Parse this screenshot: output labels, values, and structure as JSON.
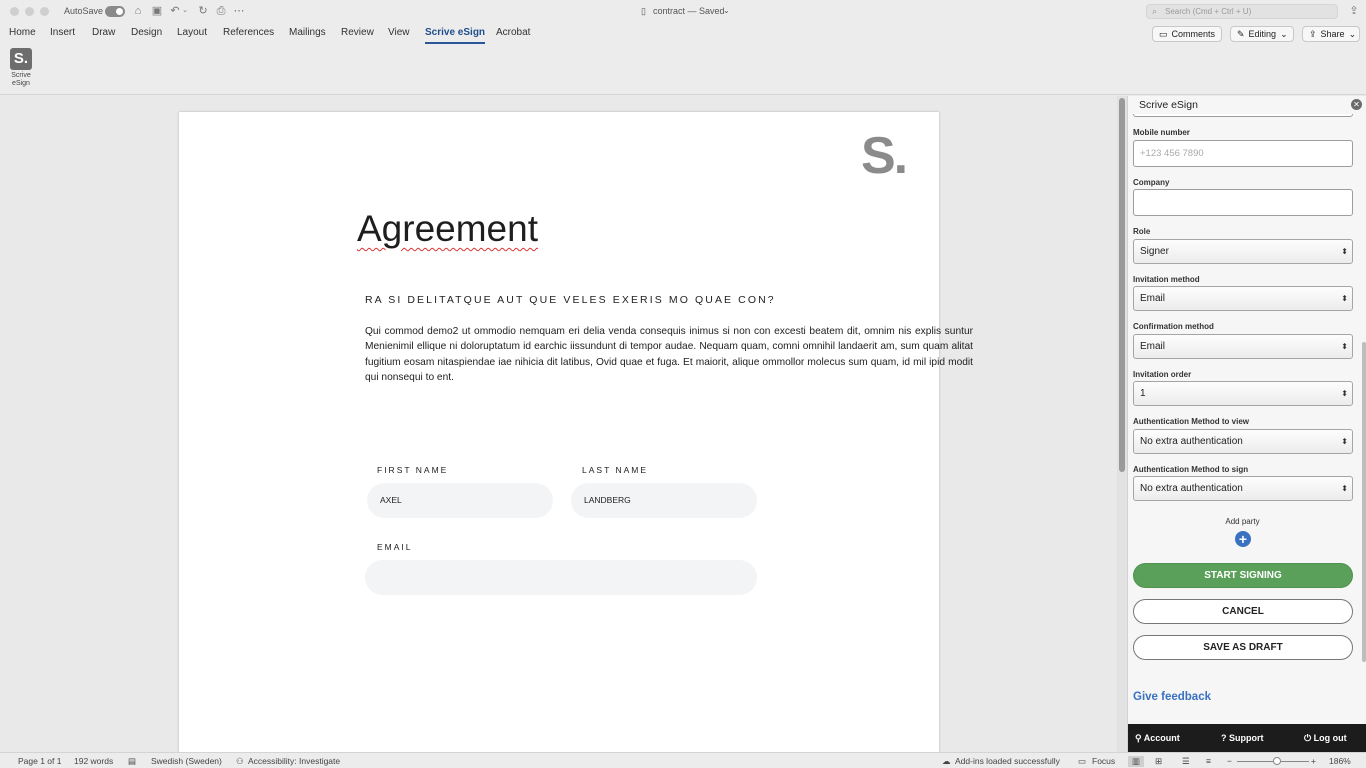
{
  "titlebar": {
    "autosave_label": "AutoSave",
    "doc_title": "contract — Saved",
    "search_placeholder": "Search (Cmd + Ctrl + U)"
  },
  "ribbon": {
    "tabs": [
      "Home",
      "Insert",
      "Draw",
      "Design",
      "Layout",
      "References",
      "Mailings",
      "Review",
      "View",
      "Scrive eSign",
      "Acrobat"
    ],
    "active_tab": "Scrive eSign",
    "comments_label": "Comments",
    "editing_label": "Editing",
    "share_label": "Share",
    "scrive_button_label": "Scrive eSign",
    "scrive_button_logo": "S."
  },
  "document": {
    "logo": "S.",
    "title": "Agreement",
    "subtitle": "RA SI DELITATQUE AUT QUE VELES EXERIS MO QUAE CON?",
    "body": "Qui commod demo2 ut ommodio nemquam eri delia venda consequis inimus si non con excesti beatem dit, omnim nis explis suntur Menienimil ellique ni doloruptatum id earchic iissundunt di tempor audae. Nequam quam, comni omnihil landaerit am, sum quam alitat fugitium eosam nitaspiendae iae nihicia dit latibus, Ovid quae et fuga. Et maiorit, alique ommollor molecus sum quam, id mil ipid modit qui nonsequi to ent.",
    "first_name_label": "FIRST NAME",
    "first_name_value": "AXEL",
    "last_name_label": "LAST NAME",
    "last_name_value": "LANDBERG",
    "email_label": "EMAIL",
    "email_value": ""
  },
  "pane": {
    "title": "Scrive eSign",
    "mobile_label": "Mobile number",
    "mobile_placeholder": "+123 456 7890",
    "company_label": "Company",
    "company_value": "",
    "role_label": "Role",
    "role_value": "Signer",
    "invitation_method_label": "Invitation method",
    "invitation_method_value": "Email",
    "confirmation_method_label": "Confirmation method",
    "confirmation_method_value": "Email",
    "invitation_order_label": "Invitation order",
    "invitation_order_value": "1",
    "auth_view_label": "Authentication Method to view",
    "auth_view_value": "No extra authentication",
    "auth_sign_label": "Authentication Method to sign",
    "auth_sign_value": "No extra authentication",
    "add_party_label": "Add party",
    "start_signing_label": "START SIGNING",
    "cancel_label": "CANCEL",
    "save_draft_label": "SAVE AS DRAFT",
    "feedback_label": "Give feedback",
    "footer": {
      "account_label": "Account",
      "support_label": "Support",
      "logout_label": "Log out"
    },
    "colors": {
      "accent_blue": "#3a71c1",
      "start_green": "#5aa05a"
    }
  },
  "statusbar": {
    "page": "Page 1 of 1",
    "words": "192 words",
    "language": "Swedish (Sweden)",
    "accessibility": "Accessibility: Investigate",
    "addins": "Add-ins loaded successfully",
    "focus": "Focus",
    "zoom": "186%"
  }
}
